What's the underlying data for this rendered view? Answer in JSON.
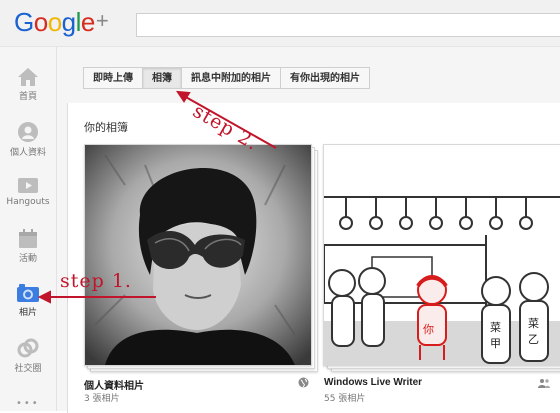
{
  "header": {
    "logo_text": "Google+"
  },
  "nav": {
    "items": [
      {
        "label": "首頁",
        "icon": "home-icon"
      },
      {
        "label": "個人資料",
        "icon": "profile-icon"
      },
      {
        "label": "Hangouts",
        "icon": "hangouts-icon"
      },
      {
        "label": "活動",
        "icon": "calendar-icon"
      },
      {
        "label": "相片",
        "icon": "camera-icon",
        "active": true
      },
      {
        "label": "社交圈",
        "icon": "circles-icon"
      }
    ],
    "more": "•••"
  },
  "tabs": [
    "即時上傳",
    "相簿",
    "訊息中附加的相片",
    "有你出現的相片"
  ],
  "active_tab": "相簿",
  "albums_heading": "你的相簿",
  "albums": [
    {
      "title": "個人資料相片",
      "count": "3 張相片",
      "icon": "globe-icon"
    },
    {
      "title": "Windows Live Writer",
      "count": "55 張相片",
      "icon": "people-icon"
    }
  ],
  "annotations": {
    "step1": "step 1.",
    "step2": "step 2."
  },
  "colors": {
    "annotation_red": "#c0152a",
    "active_blue": "#1a62d0"
  }
}
